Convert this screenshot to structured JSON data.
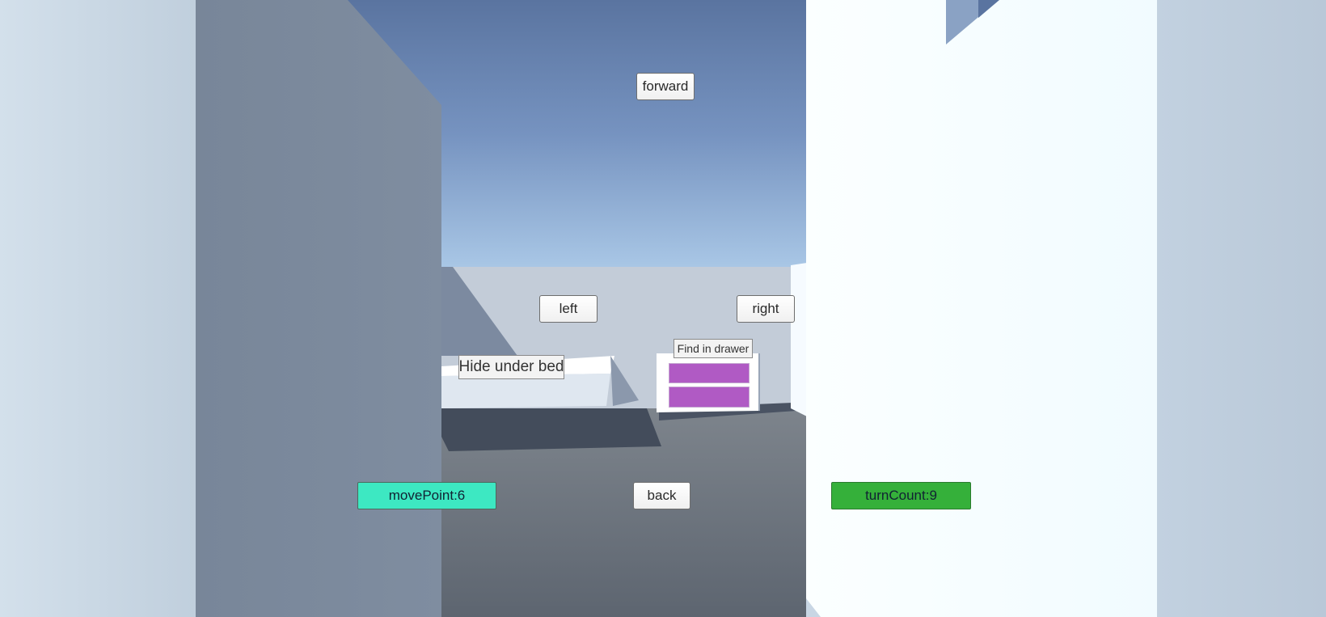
{
  "controls": {
    "forward": "forward",
    "left": "left",
    "right": "right",
    "back": "back"
  },
  "actions": {
    "hide_under_bed": "Hide under bed",
    "find_in_drawer": "Find in drawer"
  },
  "stats": {
    "move_point": "movePoint:6",
    "turn_count": "turnCount:9"
  },
  "colors": {
    "move_point_bg": "#3de8c2",
    "turn_count_bg": "#35b03a",
    "drawer_color": "#b05ac4"
  }
}
